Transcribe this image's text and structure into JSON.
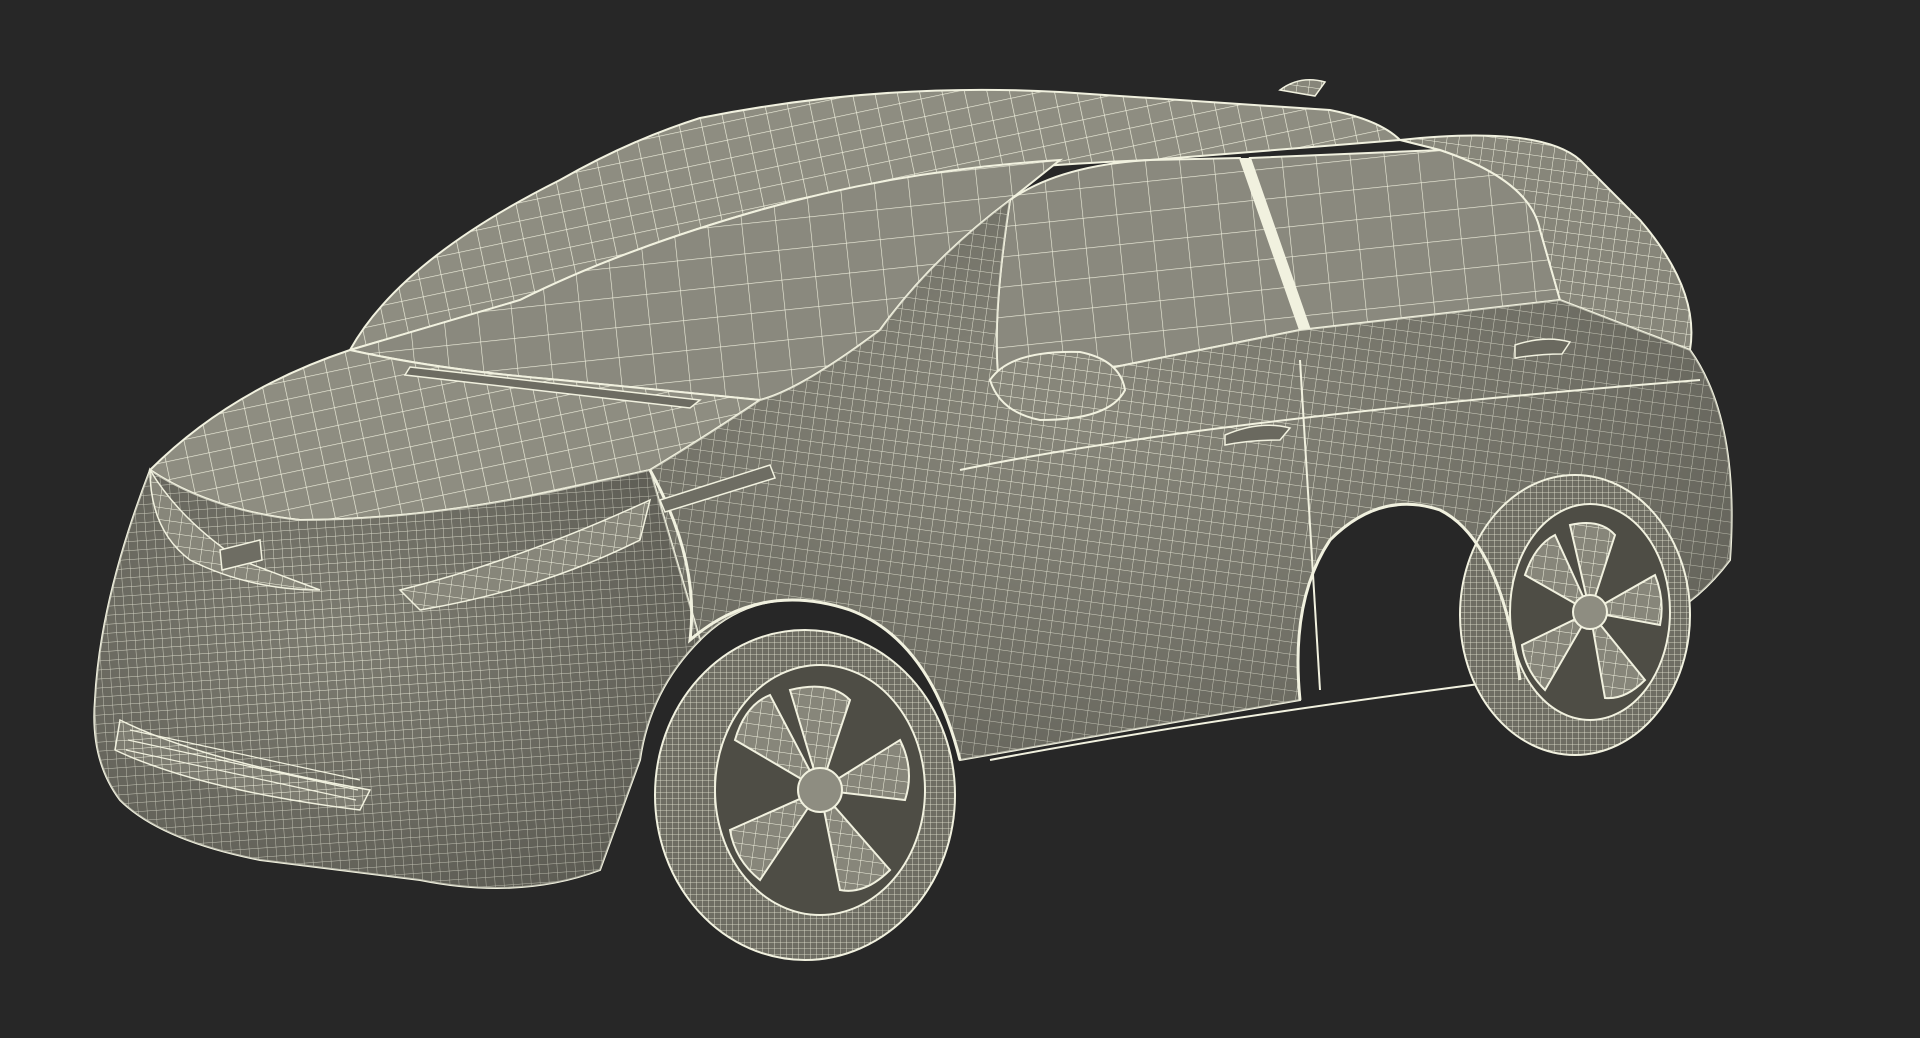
{
  "scene": {
    "background_color": "#272727",
    "model_fill_color": "#8d8c80",
    "model_shadow_color": "#5f5e55",
    "wire_color": "#f1f1df",
    "subject": "hatchback-car-wireframe"
  }
}
